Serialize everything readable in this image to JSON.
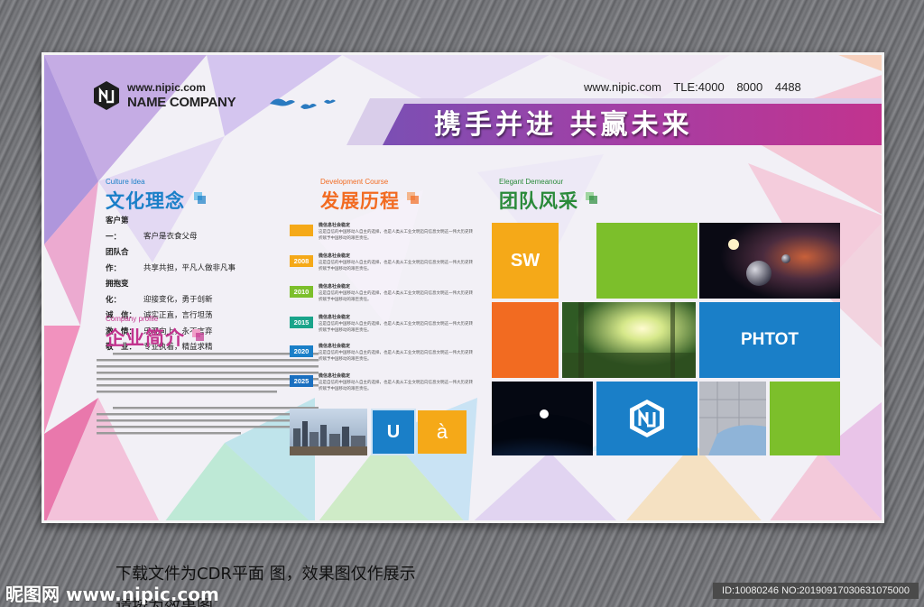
{
  "header": {
    "logo_url": "www.nipic.com",
    "logo_name": "NAME COMPANY",
    "contact": "www.nipic.com   TLE:4000 8000 4488",
    "slogan": "携手并进 共赢未来"
  },
  "culture": {
    "en": "Culture Idea",
    "cn": "文化理念",
    "items": [
      {
        "k": "客户第一：",
        "v": "客户是衣食父母"
      },
      {
        "k": "团队合作：",
        "v": "共享共担，平凡人做非凡事"
      },
      {
        "k": "拥抱变化：",
        "v": "迎接变化，勇于创新"
      },
      {
        "k": "诚　信：",
        "v": "诚实正直，言行坦荡"
      },
      {
        "k": "激　情：",
        "v": "乐观向上，永不言弃"
      },
      {
        "k": "敬　业：",
        "v": "专业执着，精益求精"
      }
    ]
  },
  "profile": {
    "en": "Company profile",
    "cn": "企业简介"
  },
  "development": {
    "en": "Development Course",
    "cn": "发展历程",
    "title": "微信息社会稳定",
    "body": "这是自信的中国移动人自主的选择，也是人类从工业文明迈向信息文明这一伟大历史转折赋予中国移动的艰巨责任。",
    "years": [
      "",
      "2008",
      "2010",
      "2015",
      "2020",
      "2025"
    ]
  },
  "team": {
    "en": "Elegant Demeanour",
    "cn": "团队风采",
    "tile_sw": "SW",
    "tile_phtot": "PHTOT"
  },
  "photos_dev": {
    "letter_u": "U",
    "letter_a": "à"
  },
  "caption": "下载文件为CDR平面 图，效果图仅作展示",
  "caption2": "请按为效果图",
  "watermark": {
    "left": "昵图网 www.nipic.com",
    "id": "ID:10080246 NO:20190917030631075000"
  },
  "colors": {
    "purple": "#7a3d9e",
    "magenta": "#c13b8f",
    "blue": "#1a7fc8",
    "orange": "#f26b21",
    "green": "#7cbf2b",
    "yellow": "#f5a918"
  }
}
